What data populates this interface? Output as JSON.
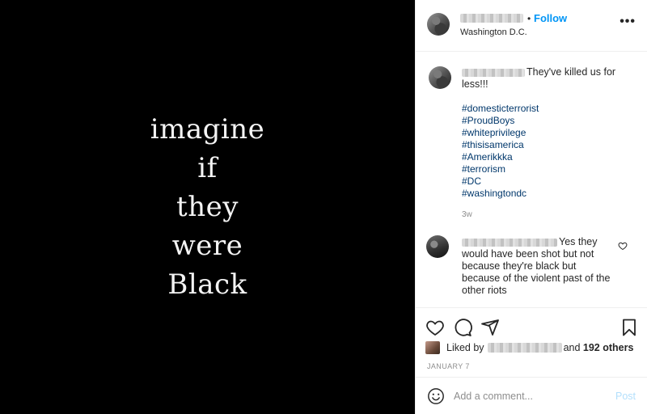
{
  "post_image": {
    "lines": [
      "imagine",
      "if",
      "they",
      "were",
      "Black"
    ],
    "background": "#000000"
  },
  "header": {
    "follow_separator": "•",
    "follow_label": "Follow",
    "location": "Washington D.C.",
    "more_label": "•••"
  },
  "caption": {
    "text": "They've killed us for less!!!",
    "hashtags": [
      "#domesticterrorist",
      "#ProudBoys",
      "#whiteprivilege",
      "#thisisamerica",
      "#Amerikkka",
      "#terrorism",
      "#DC",
      "#washingtondc"
    ],
    "time": "3w"
  },
  "reply": {
    "text": "Yes they would have been shot but not because they're black but because of the violent past of the other riots"
  },
  "likes": {
    "prefix": "Liked by",
    "suffix": "and",
    "others": "192 others"
  },
  "date": "JANUARY 7",
  "comment_box": {
    "placeholder": "Add a comment...",
    "post_label": "Post"
  },
  "colors": {
    "link_blue": "#0095f6",
    "hashtag_blue": "#00376b",
    "muted": "#8e8e8e",
    "post_disabled": "#b2dffc"
  }
}
